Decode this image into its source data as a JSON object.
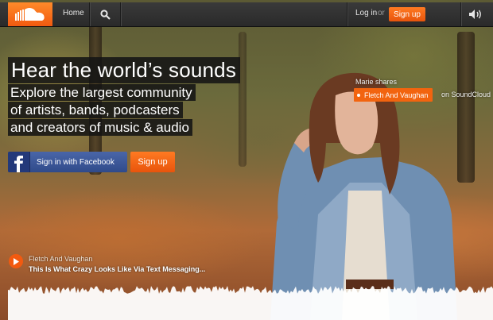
{
  "nav": {
    "home_label": "Home",
    "login_label": "Log in",
    "or_label": "or",
    "signup_label": "Sign up",
    "icons": [
      "soundcloud-logo",
      "search-icon",
      "volume-icon"
    ]
  },
  "hero": {
    "headline": "Hear the world’s sounds",
    "subline": [
      "Explore the largest community",
      "of artists, bands, podcasters",
      "and creators of music & audio"
    ],
    "facebook_button": "Sign in with Facebook",
    "signup_button": "Sign up"
  },
  "share": {
    "who": "Marie shares",
    "artist": "Fletch And Vaughan",
    "where": "on SoundCloud"
  },
  "player": {
    "artist": "Fletch And Vaughan",
    "track": "This Is What Crazy Looks Like Via Text Messaging..."
  },
  "colors": {
    "accent": "#f25a10",
    "nav_bg": "#333333",
    "facebook": "#3b5998"
  }
}
